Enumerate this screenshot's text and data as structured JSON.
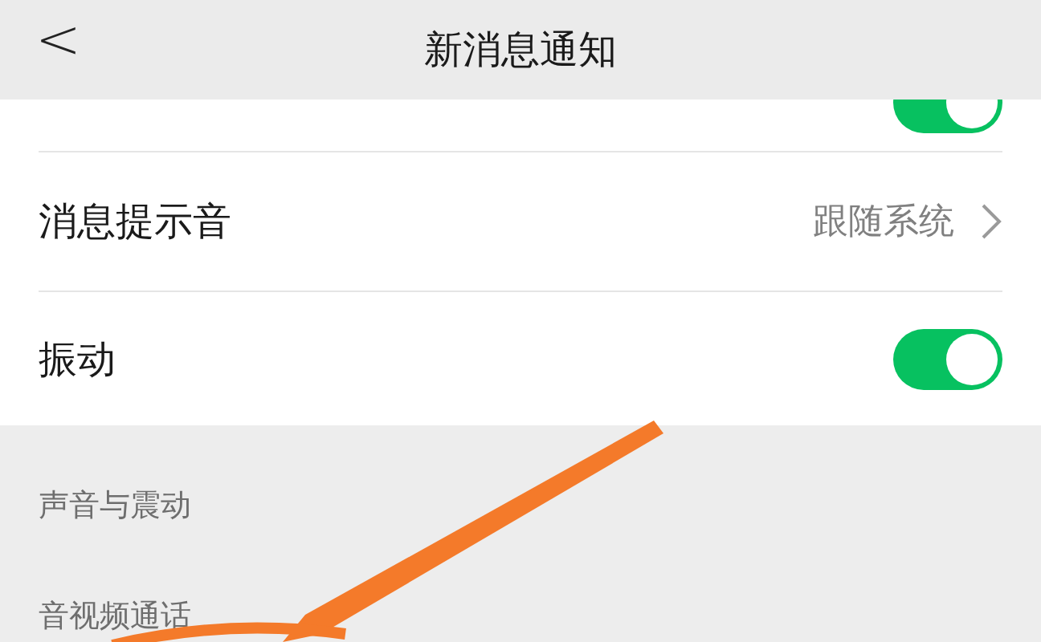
{
  "header": {
    "back": "<",
    "title": "新消息通知"
  },
  "rows": [
    {
      "kind": "toggle",
      "on": true
    },
    {
      "kind": "value",
      "label": "消息提示音",
      "value": "跟随系统"
    },
    {
      "kind": "toggle",
      "label": "振动",
      "on": true
    }
  ],
  "sections": [
    "声音与震动",
    "音视频通话"
  ]
}
